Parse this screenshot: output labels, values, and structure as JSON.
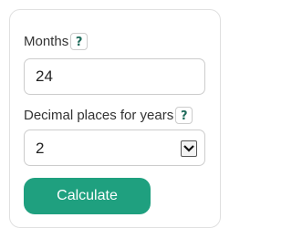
{
  "form": {
    "months": {
      "label": "Months",
      "help": "?",
      "value": "24"
    },
    "decimals": {
      "label": "Decimal places for years",
      "help": "?",
      "value": "2"
    },
    "calculate_label": "Calculate"
  },
  "colors": {
    "accent": "#1fa07f",
    "help_text": "#1f6b5b"
  },
  "icons": {
    "select_arrow": "chevron-down-icon"
  }
}
